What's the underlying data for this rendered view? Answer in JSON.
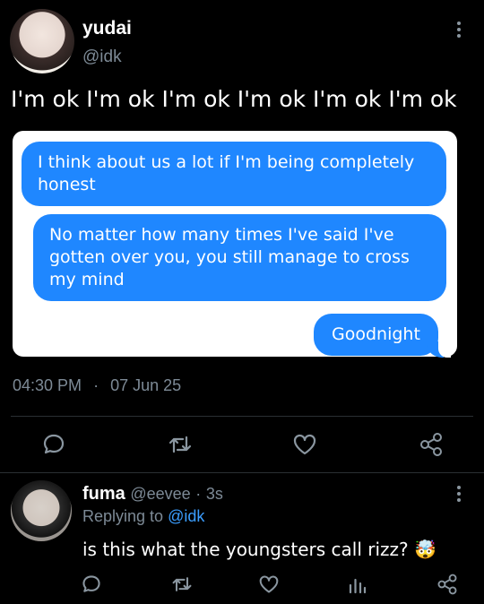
{
  "post": {
    "display_name": "yudai",
    "handle": "@idk",
    "text": "I'm ok I'm ok I'm ok I'm ok I'm ok I'm ok",
    "time": "04:30 PM",
    "separator": "·",
    "date": "07 Jun 25",
    "messages": [
      "I think about us a lot if I'm being completely honest",
      "No matter how many times I've said I've gotten over you, you still manage to cross my mind",
      "Goodnight"
    ]
  },
  "reply": {
    "display_name": "fuma",
    "handle": "@eevee",
    "separator": "·",
    "time_ago": "3s",
    "replying_prefix": "Replying to",
    "replying_handle": "@idk",
    "text": "is this what the youngsters call rizz?",
    "emoji": "🤯"
  },
  "icons": {
    "post_actions": [
      "comment-icon",
      "retweet-icon",
      "heart-icon",
      "share-icon"
    ],
    "reply_actions": [
      "comment-icon",
      "retweet-icon",
      "heart-icon",
      "stats-icon",
      "share-icon"
    ],
    "more": "more-vertical-icon"
  },
  "colors": {
    "background": "#000000",
    "bubble": "#1f87ff",
    "link": "#3b9eff",
    "muted": "#7d8a96"
  }
}
